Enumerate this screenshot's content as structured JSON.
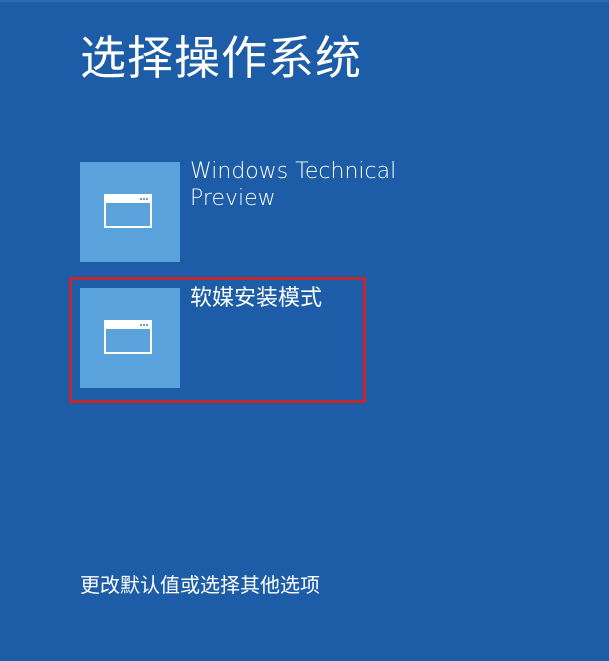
{
  "screen": {
    "title": "选择操作系统",
    "background_color": "#1d5ca6"
  },
  "os_list": [
    {
      "name": "Windows Technical Preview",
      "name_lines": [
        "Windows Technical",
        "Preview"
      ],
      "icon": "window-icon",
      "tile_color": "#5aa2dc",
      "selected": false
    },
    {
      "name": "软媒安装模式",
      "icon": "window-icon",
      "tile_color": "#5aa2dc",
      "selected": true,
      "highlight_color": "#c1272d"
    }
  ],
  "footer": {
    "change_defaults_link": "更改默认值或选择其他选项"
  }
}
